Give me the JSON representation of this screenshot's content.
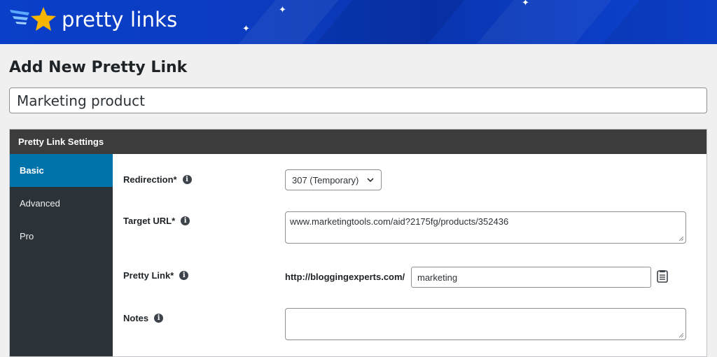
{
  "brand": {
    "name": "pretty links"
  },
  "page": {
    "title": "Add New Pretty Link"
  },
  "title_field": {
    "value": "Marketing product"
  },
  "settings": {
    "header": "Pretty Link Settings",
    "tabs": [
      {
        "label": "Basic",
        "active": true
      },
      {
        "label": "Advanced",
        "active": false
      },
      {
        "label": "Pro",
        "active": false
      }
    ],
    "redirection": {
      "label": "Redirection*",
      "value": "307 (Temporary)"
    },
    "target_url": {
      "label": "Target URL*",
      "value": "www.marketingtools.com/aid?2175fg/products/352436"
    },
    "pretty_link": {
      "label": "Pretty Link*",
      "prefix": "http://bloggingexperts.com/",
      "slug": "marketing"
    },
    "notes": {
      "label": "Notes",
      "value": ""
    }
  },
  "icons": {
    "info": "info-icon",
    "clipboard": "clipboard-icon",
    "chevron": "chevron-down-icon"
  },
  "colors": {
    "banner": "#0a3fc9",
    "active_tab": "#0073aa",
    "sidenav": "#2c3338",
    "box_header": "#3c3c3c"
  }
}
